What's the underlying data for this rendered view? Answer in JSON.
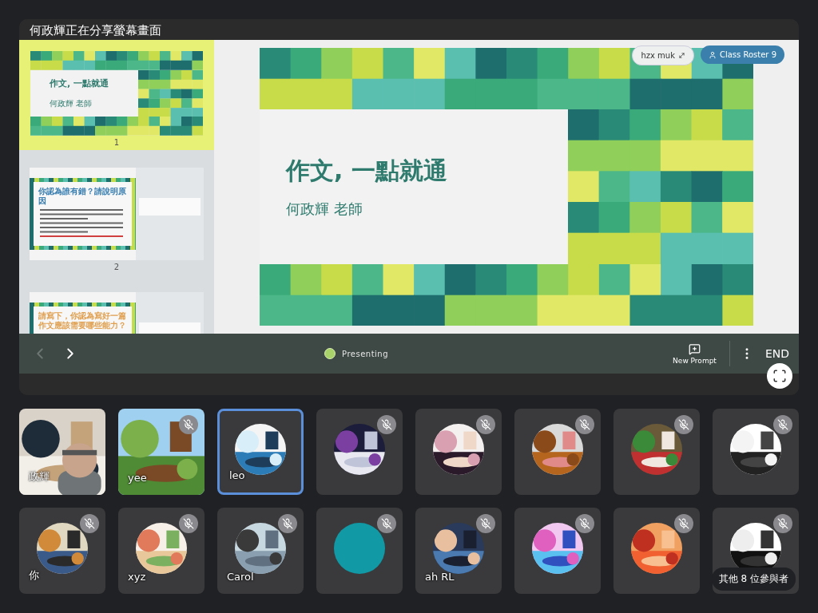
{
  "share_banner": {
    "title": "何政輝正在分享螢幕畫面"
  },
  "slides": [
    {
      "number": "1",
      "selected": true,
      "kind": "title",
      "title": "作文, 一點就通",
      "subtitle": "何政輝 老師"
    },
    {
      "number": "2",
      "selected": false,
      "kind": "question",
      "title": "你認為誰有錯？請說明原因"
    },
    {
      "selected": false,
      "kind": "question",
      "title": "請寫下，你認為寫好一篇作文應該需要哪些能力？"
    }
  ],
  "current_slide": {
    "title": "作文, 一點就通",
    "subtitle": "何政輝 老師"
  },
  "chips": [
    {
      "label": "hzx muk",
      "kind": "expand"
    },
    {
      "label": "Class Roster 9",
      "kind": "roster"
    }
  ],
  "controls": {
    "prev": {
      "disabled": true
    },
    "next": {
      "disabled": false
    },
    "status": "Presenting",
    "new_prompt": "New Prompt",
    "end": "END"
  },
  "participants": [
    {
      "name": "政輝",
      "kind": "video",
      "muted": false,
      "selected": false
    },
    {
      "name": "yee",
      "kind": "picture",
      "muted": true,
      "selected": false
    },
    {
      "name": "leo",
      "kind": "avatar",
      "muted": false,
      "selected": true
    },
    {
      "kind": "avatar",
      "muted": true,
      "selected": false
    },
    {
      "kind": "avatar",
      "muted": true,
      "selected": false
    },
    {
      "kind": "avatar",
      "muted": true,
      "selected": false
    },
    {
      "kind": "avatar",
      "muted": true,
      "selected": false
    },
    {
      "kind": "avatar",
      "muted": true,
      "selected": false
    },
    {
      "name": "你",
      "kind": "avatar",
      "muted": true,
      "selected": false
    },
    {
      "name": "xyz",
      "kind": "avatar",
      "muted": true,
      "selected": false
    },
    {
      "name": "Carol",
      "kind": "avatar",
      "muted": true,
      "selected": false
    },
    {
      "kind": "color-avatar",
      "color": "#1199a6",
      "muted": true,
      "selected": false
    },
    {
      "name": "ah RL",
      "kind": "avatar",
      "muted": true,
      "selected": false
    },
    {
      "kind": "avatar",
      "muted": true,
      "selected": false
    },
    {
      "kind": "avatar",
      "muted": true,
      "selected": false
    },
    {
      "kind": "avatar",
      "muted": true,
      "selected": false
    }
  ],
  "more_participants": "其他 8 位參與者"
}
